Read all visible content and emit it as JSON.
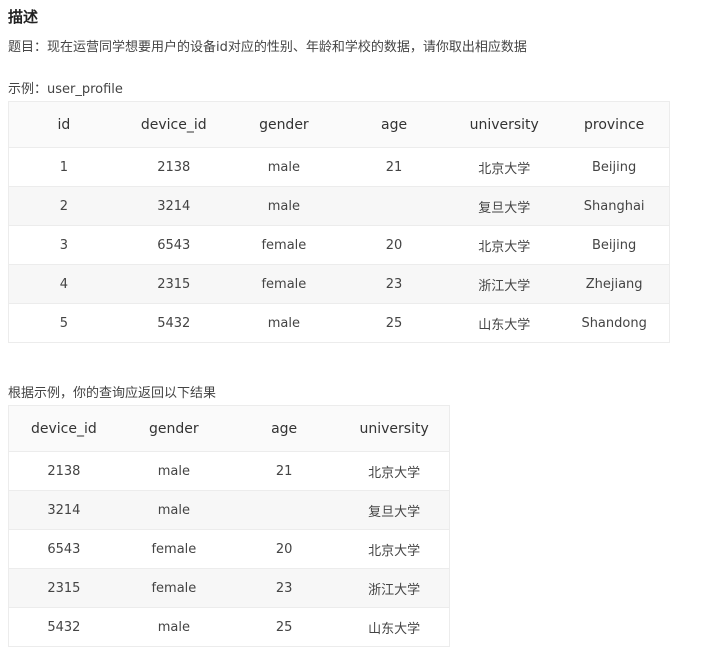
{
  "heading": "描述",
  "description": "题目：现在运营同学想要用户的设备id对应的性别、年龄和学校的数据，请你取出相应数据",
  "example": {
    "caption": "示例：user_profile",
    "columns": [
      "id",
      "device_id",
      "gender",
      "age",
      "university",
      "province"
    ],
    "rows": [
      [
        "1",
        "2138",
        "male",
        "21",
        "北京大学",
        "Beijing"
      ],
      [
        "2",
        "3214",
        "male",
        "",
        "复旦大学",
        "Shanghai"
      ],
      [
        "3",
        "6543",
        "female",
        "20",
        "北京大学",
        "Beijing"
      ],
      [
        "4",
        "2315",
        "female",
        "23",
        "浙江大学",
        "Zhejiang"
      ],
      [
        "5",
        "5432",
        "male",
        "25",
        "山东大学",
        "Shandong"
      ]
    ]
  },
  "result": {
    "caption": "根据示例，你的查询应返回以下结果",
    "columns": [
      "device_id",
      "gender",
      "age",
      "university"
    ],
    "rows": [
      [
        "2138",
        "male",
        "21",
        "北京大学"
      ],
      [
        "3214",
        "male",
        "",
        "复旦大学"
      ],
      [
        "6543",
        "female",
        "20",
        "北京大学"
      ],
      [
        "2315",
        "female",
        "23",
        "浙江大学"
      ],
      [
        "5432",
        "male",
        "25",
        "山东大学"
      ]
    ]
  }
}
